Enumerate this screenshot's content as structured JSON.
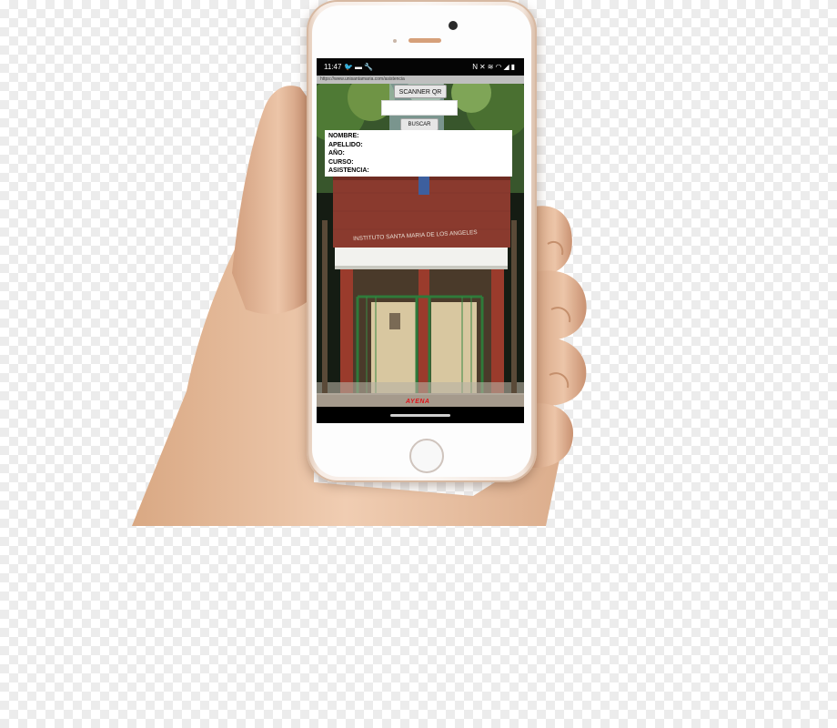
{
  "status_bar": {
    "time": "11:47",
    "left_icons": [
      "twitter-icon",
      "message-icon",
      "wrench-icon"
    ],
    "right_icons": [
      "nfc-icon",
      "mute-icon",
      "vibrate-icon",
      "wifi-icon",
      "signal-icon",
      "battery-icon"
    ]
  },
  "browser": {
    "url": "https://www.unisantamaria.com/asistencia"
  },
  "app": {
    "scan_button": "SCANNER QR",
    "code_value": "",
    "search_button": "BUSCAR",
    "fields": [
      {
        "label": "NOMBRE:"
      },
      {
        "label": "APELLIDO:"
      },
      {
        "label": "AÑO:"
      },
      {
        "label": "CURSO:"
      },
      {
        "label": "ASISTENCIA:"
      }
    ],
    "building_sign": "INSTITUTO SANTA MARIA DE LOS ANGELES",
    "footer_mark": "AYENA"
  },
  "colors": {
    "phone_body": "#f7ede6",
    "skin": "#e9c2a4",
    "brick": "#8a3a2e",
    "footer_red": "#e0141b"
  }
}
